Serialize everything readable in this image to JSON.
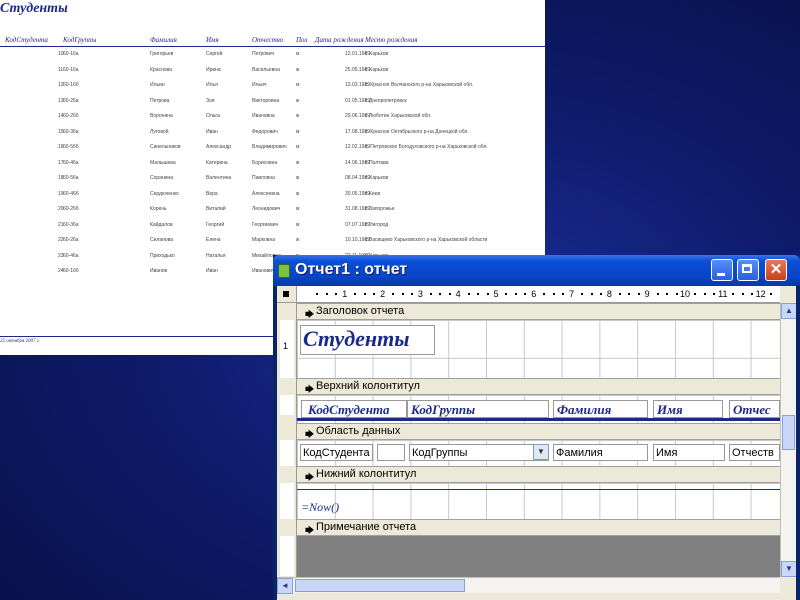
{
  "report_preview": {
    "title": "Студенты",
    "columns": [
      "КодСтудента",
      "КодГруппы",
      "Фамилия",
      "Имя",
      "Отчество",
      "Пол",
      "Дата рождения",
      "Место рождения"
    ],
    "rows": [
      [
        "10",
        "60-16а",
        "Григорьев",
        "Сергей",
        "Петрович",
        "м",
        "12.01.1989",
        "г. Харьков"
      ],
      [
        "11",
        "60-16а",
        "Краснова",
        "Ирина",
        "Васильевна",
        "ж",
        "25.05.1989",
        "г. Харьков"
      ],
      [
        "12",
        "60-16б",
        "Ильин",
        "Илья",
        "Ильич",
        "м",
        "13.03.1989",
        "с. Красное Волчанского р-на Харьковской обл."
      ],
      [
        "13",
        "60-26а",
        "Петрова",
        "Зоя",
        "Викторовна",
        "ж",
        "01.05.1989",
        "г. Днепропетровск"
      ],
      [
        "14",
        "60-26б",
        "Воронина",
        "Ольга",
        "Ивановна",
        "ж",
        "29.06.1989",
        "г. Люботин Харьковской обл."
      ],
      [
        "15",
        "60-36а",
        "Луговой",
        "Иван",
        "Федорович",
        "м",
        "17.08.1989",
        "с. Красное Октябрьского р-на Донецкой обл."
      ],
      [
        "16",
        "60-56б",
        "Синельников",
        "Александр",
        "Владимирович",
        "м",
        "12.02.1989",
        "с. Петровское Богодуховского р-на Харьковской обл."
      ],
      [
        "17",
        "60-46а",
        "Малышева",
        "Катерина",
        "Борисовна",
        "ж",
        "14.06.1989",
        "г. Полтава"
      ],
      [
        "18",
        "60-56а",
        "Соранина",
        "Валентина",
        "Павловна",
        "ж",
        "08.04.1989",
        "г. Харьков"
      ],
      [
        "19",
        "60-46б",
        "Сердюченко",
        "Вера",
        "Алексеевна",
        "ж",
        "30.05.1989",
        "г. Киев"
      ],
      [
        "20",
        "60-26б",
        "Корень",
        "Виталий",
        "Леонидович",
        "м",
        "31.08.1989",
        "г. Запорожье"
      ],
      [
        "21",
        "60-36а",
        "Кайдалов",
        "Георгий",
        "Георгиевич",
        "м",
        "07.07.1989",
        "г. Ужгород"
      ],
      [
        "22",
        "60-26а",
        "Силанова",
        "Елена",
        "Марковна",
        "ж",
        "10.10.1989",
        "с.Васищево Харьковского р-на Харьковской области"
      ],
      [
        "23",
        "60-46а",
        "Приходько",
        "Наталья",
        "Михайловна",
        "ж",
        "22.11.1989",
        "г. Харьков"
      ],
      [
        "24",
        "60-16б",
        "Иванов",
        "Иван",
        "Иванович",
        "м",
        "02.08.1989",
        "г. Харьков"
      ]
    ],
    "footer_date": "25 октября 2007 г."
  },
  "window": {
    "title": "Отчет1 : отчет",
    "minimize": "minimize",
    "maximize": "maximize",
    "close": "✕"
  },
  "ruler": {
    "marks": [
      "1",
      "2",
      "3",
      "4",
      "5",
      "6",
      "7",
      "8",
      "9",
      "10",
      "11",
      "12"
    ],
    "vertical_mark": "1"
  },
  "sections": {
    "report_header": "Заголовок отчета",
    "page_header": "Верхний колонтитул",
    "detail": "Область данных",
    "page_footer": "Нижний колонтитул",
    "report_footer": "Примечание отчета"
  },
  "design": {
    "title_label": "Студенты",
    "header_labels": [
      "КодСтудента",
      "КодГруппы",
      "Фамилия",
      "Имя",
      "Отчес"
    ],
    "detail_fields": [
      "КодСтудента",
      "КодГруппы",
      "Фамилия",
      "Имя",
      "Отчеств"
    ],
    "footer_expression": "=Now()"
  },
  "icons": {
    "band_arrow": "band-arrow-icon",
    "scroll_up": "▲",
    "scroll_down": "▼",
    "scroll_left": "◄",
    "combo_arrow": "▼"
  },
  "colors": {
    "titlebar": "#0a44c8",
    "label_text": "#1a2a8a",
    "desktop": "#0f1c6e"
  }
}
